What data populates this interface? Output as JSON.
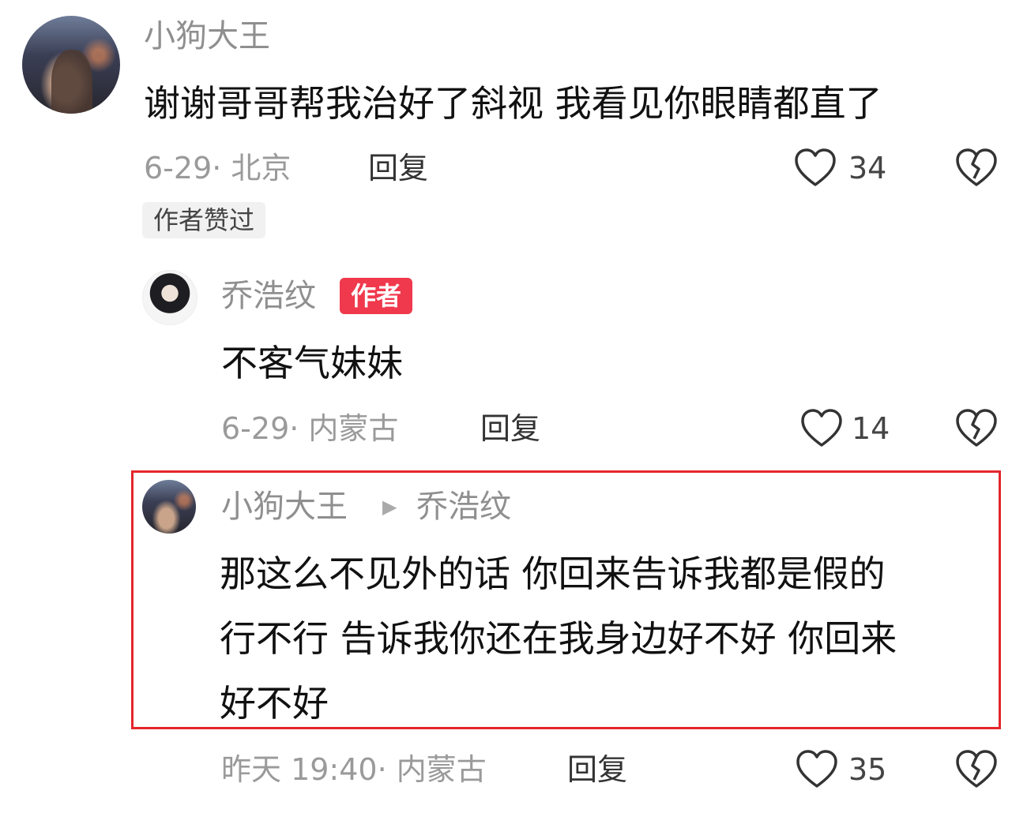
{
  "comment": {
    "username": "小狗大王",
    "text": "谢谢哥哥帮我治好了斜视 我看见你眼睛都直了",
    "meta": "6-29· 北京",
    "reply_label": "回复",
    "like_count": "34",
    "tag": "作者赞过"
  },
  "author_reply": {
    "username": "乔浩纹",
    "badge": "作者",
    "text": "不客气妹妹",
    "meta": "6-29· 内蒙古",
    "reply_label": "回复",
    "like_count": "14"
  },
  "sub_reply": {
    "username": "小狗大王",
    "reply_to": "乔浩纹",
    "lines": [
      "那这么不见外的话 你回来告诉我都是假的",
      "行不行 告诉我你还在我身边好不好 你回来",
      "好不好"
    ],
    "meta": "昨天 19:40· 内蒙古",
    "reply_label": "回复",
    "like_count": "35"
  },
  "icons": {
    "like": "heart-outline-icon",
    "dislike": "broken-heart-icon",
    "reply_arrow": "right-triangle-icon"
  },
  "colors": {
    "highlight_border": "#e3262b",
    "author_badge": "#f0394d",
    "secondary_text": "#8f8f8f"
  }
}
